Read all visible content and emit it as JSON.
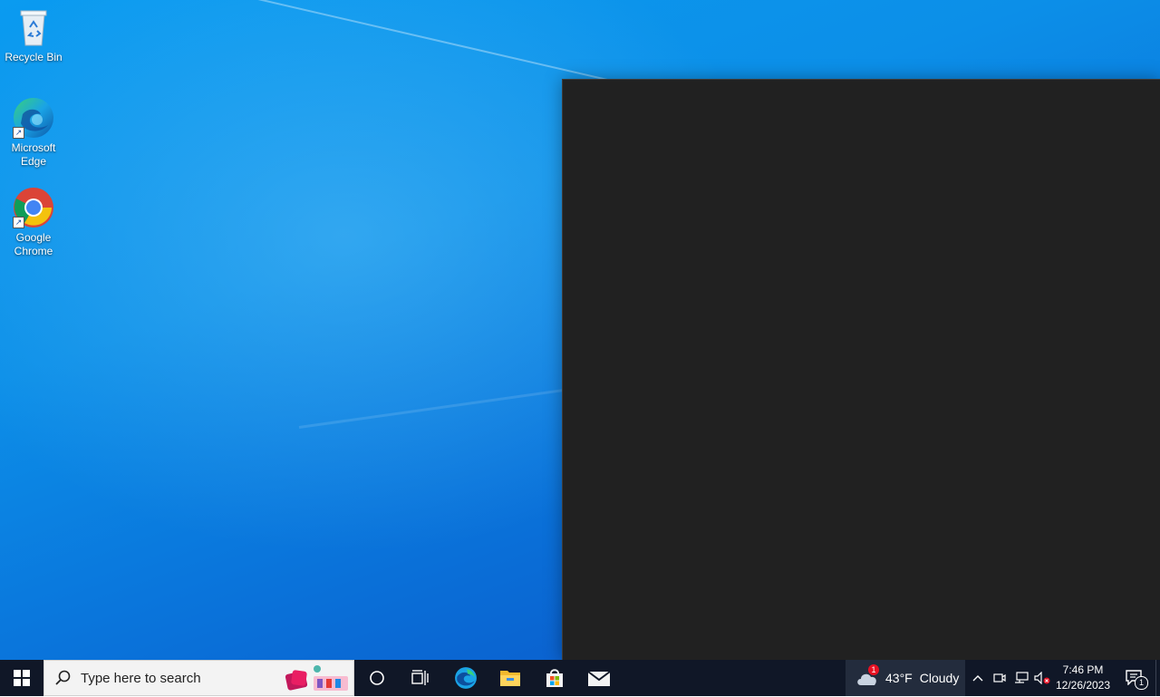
{
  "desktop": {
    "icons": [
      {
        "label": "Recycle Bin",
        "icon": "recycle-bin-icon"
      },
      {
        "label": "Microsoft\nEdge",
        "icon": "edge-icon"
      },
      {
        "label": "Google\nChrome",
        "icon": "chrome-icon"
      }
    ]
  },
  "taskbar": {
    "search_placeholder": "Type here to search",
    "pinned": [
      {
        "name": "cortana",
        "icon": "cortana-circle-icon"
      },
      {
        "name": "task-view",
        "icon": "task-view-icon"
      },
      {
        "name": "edge",
        "icon": "edge-icon"
      },
      {
        "name": "file-explorer",
        "icon": "folder-icon"
      },
      {
        "name": "store",
        "icon": "store-icon"
      },
      {
        "name": "mail",
        "icon": "mail-icon"
      }
    ],
    "weather": {
      "temperature": "43°F",
      "condition": "Cloudy",
      "badge": "1"
    },
    "clock": {
      "time": "7:46 PM",
      "date": "12/26/2023"
    },
    "notification_count": "1"
  },
  "colors": {
    "taskbar": "#101727",
    "window": "#212121",
    "desktop_accent": "#0a8fe8"
  }
}
